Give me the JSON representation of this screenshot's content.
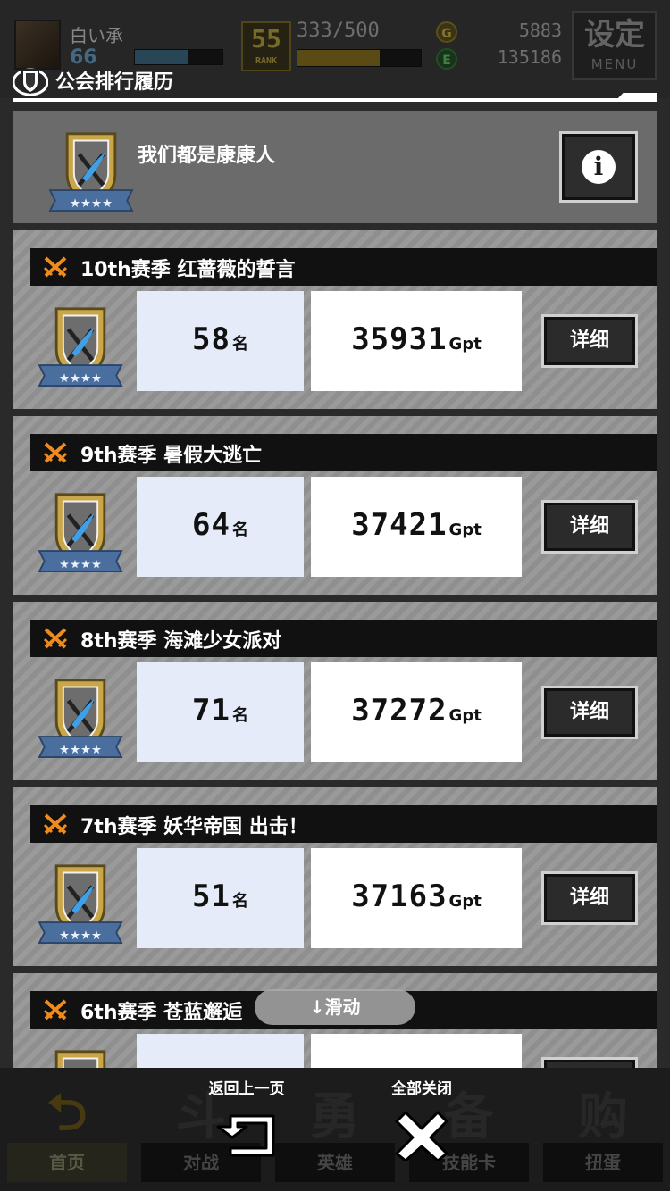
{
  "top": {
    "player_name": "白い承",
    "player_level": "66",
    "player_exp_fraction": 0.6,
    "rank_badge": {
      "big": "55",
      "small": "RANK"
    },
    "stamina_text": "333/500",
    "stamina_fraction": 0.666,
    "gold_icon": "G",
    "gold": "5883",
    "energy_icon": "E",
    "energy": "135186",
    "menu_kanji": "设定",
    "menu_label": "MENU"
  },
  "panel": {
    "title": "公会排行履历",
    "title_icon": "guild-shield-icon"
  },
  "guild": {
    "name": "我们都是康康人",
    "emblem_icon": "crossed-swords-shield-emblem",
    "emblem_stars": 4,
    "info_symbol": "i"
  },
  "seasons": [
    {
      "label": "10th赛季  红蔷薇的誓言",
      "rank": "58",
      "rank_unit": "名",
      "points": "35931",
      "points_unit": "Gpt",
      "detail": "详细"
    },
    {
      "label": "9th赛季  暑假大逃亡",
      "rank": "64",
      "rank_unit": "名",
      "points": "37421",
      "points_unit": "Gpt",
      "detail": "详细"
    },
    {
      "label": "8th赛季  海滩少女派对",
      "rank": "71",
      "rank_unit": "名",
      "points": "37272",
      "points_unit": "Gpt",
      "detail": "详细"
    },
    {
      "label": "7th赛季  妖华帝国  出击！",
      "rank": "51",
      "rank_unit": "名",
      "points": "37163",
      "points_unit": "Gpt",
      "detail": "详细"
    },
    {
      "label": "6th赛季  苍蓝邂逅",
      "rank": "",
      "rank_unit": "",
      "points": "",
      "points_unit": "",
      "detail": ""
    }
  ],
  "scroll_hint": "↓滑动",
  "overlay": {
    "back_label": "返回上一页",
    "close_all_label": "全部关闭"
  },
  "bottom_nav": [
    {
      "glyph": "⮌",
      "label": "首页"
    },
    {
      "glyph": "斗",
      "label": "对战"
    },
    {
      "glyph": "勇",
      "label": "英雄"
    },
    {
      "glyph": "备",
      "label": "技能卡"
    },
    {
      "glyph": "购",
      "label": "扭蛋"
    }
  ],
  "colors": {
    "accent_orange": "#f08a1c",
    "rank_cell_bg": "#e6ebfa",
    "header_bg": "#111111"
  }
}
